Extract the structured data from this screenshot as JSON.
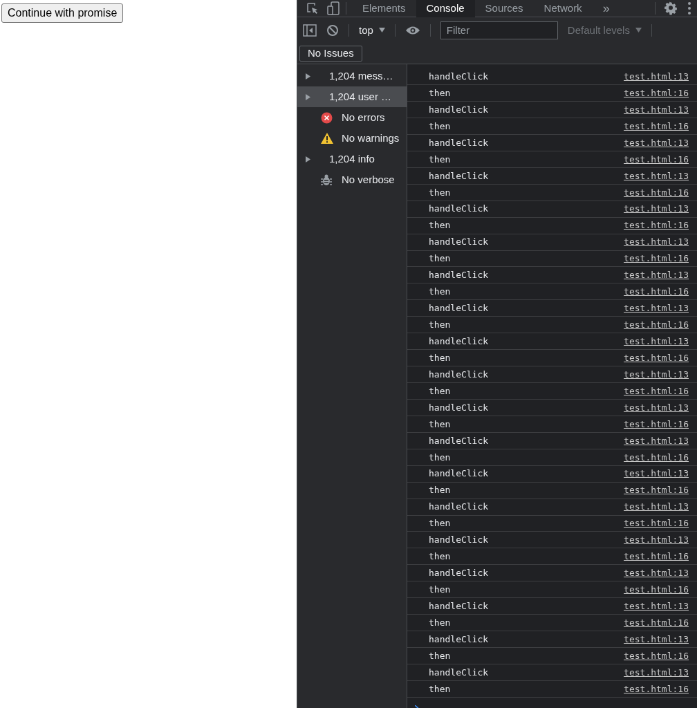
{
  "page": {
    "button": "Continue with promise"
  },
  "devtools": {
    "tabs": [
      {
        "label": "Elements",
        "selected": false
      },
      {
        "label": "Console",
        "selected": true
      },
      {
        "label": "Sources",
        "selected": false
      },
      {
        "label": "Network",
        "selected": false
      }
    ],
    "more_tabs": "»",
    "toolbar": {
      "context": "top",
      "filter": {
        "placeholder": "Filter"
      },
      "levels": "Default levels"
    },
    "issues": "No Issues",
    "sidebar": [
      {
        "kind": "group",
        "label": "1,204 mess…",
        "selected": false
      },
      {
        "kind": "group",
        "label": "1,204 user …",
        "selected": true
      },
      {
        "kind": "error",
        "label": "No errors",
        "selected": false
      },
      {
        "kind": "warning",
        "label": "No warnings",
        "selected": false
      },
      {
        "kind": "group",
        "label": "1,204 info",
        "selected": false
      },
      {
        "kind": "verbose",
        "label": "No verbose",
        "selected": false
      }
    ],
    "logs": [
      {
        "message": "handleClick",
        "source": "test.html:13"
      },
      {
        "message": "then",
        "source": "test.html:16"
      },
      {
        "message": "handleClick",
        "source": "test.html:13"
      },
      {
        "message": "then",
        "source": "test.html:16"
      },
      {
        "message": "handleClick",
        "source": "test.html:13"
      },
      {
        "message": "then",
        "source": "test.html:16"
      },
      {
        "message": "handleClick",
        "source": "test.html:13"
      },
      {
        "message": "then",
        "source": "test.html:16"
      },
      {
        "message": "handleClick",
        "source": "test.html:13"
      },
      {
        "message": "then",
        "source": "test.html:16"
      },
      {
        "message": "handleClick",
        "source": "test.html:13"
      },
      {
        "message": "then",
        "source": "test.html:16"
      },
      {
        "message": "handleClick",
        "source": "test.html:13"
      },
      {
        "message": "then",
        "source": "test.html:16"
      },
      {
        "message": "handleClick",
        "source": "test.html:13"
      },
      {
        "message": "then",
        "source": "test.html:16"
      },
      {
        "message": "handleClick",
        "source": "test.html:13"
      },
      {
        "message": "then",
        "source": "test.html:16"
      },
      {
        "message": "handleClick",
        "source": "test.html:13"
      },
      {
        "message": "then",
        "source": "test.html:16"
      },
      {
        "message": "handleClick",
        "source": "test.html:13"
      },
      {
        "message": "then",
        "source": "test.html:16"
      },
      {
        "message": "handleClick",
        "source": "test.html:13"
      },
      {
        "message": "then",
        "source": "test.html:16"
      },
      {
        "message": "handleClick",
        "source": "test.html:13"
      },
      {
        "message": "then",
        "source": "test.html:16"
      },
      {
        "message": "handleClick",
        "source": "test.html:13"
      },
      {
        "message": "then",
        "source": "test.html:16"
      },
      {
        "message": "handleClick",
        "source": "test.html:13"
      },
      {
        "message": "then",
        "source": "test.html:16"
      },
      {
        "message": "handleClick",
        "source": "test.html:13"
      },
      {
        "message": "then",
        "source": "test.html:16"
      },
      {
        "message": "handleClick",
        "source": "test.html:13"
      },
      {
        "message": "then",
        "source": "test.html:16"
      },
      {
        "message": "handleClick",
        "source": "test.html:13"
      },
      {
        "message": "then",
        "source": "test.html:16"
      },
      {
        "message": "handleClick",
        "source": "test.html:13"
      },
      {
        "message": "then",
        "source": "test.html:16"
      }
    ]
  }
}
